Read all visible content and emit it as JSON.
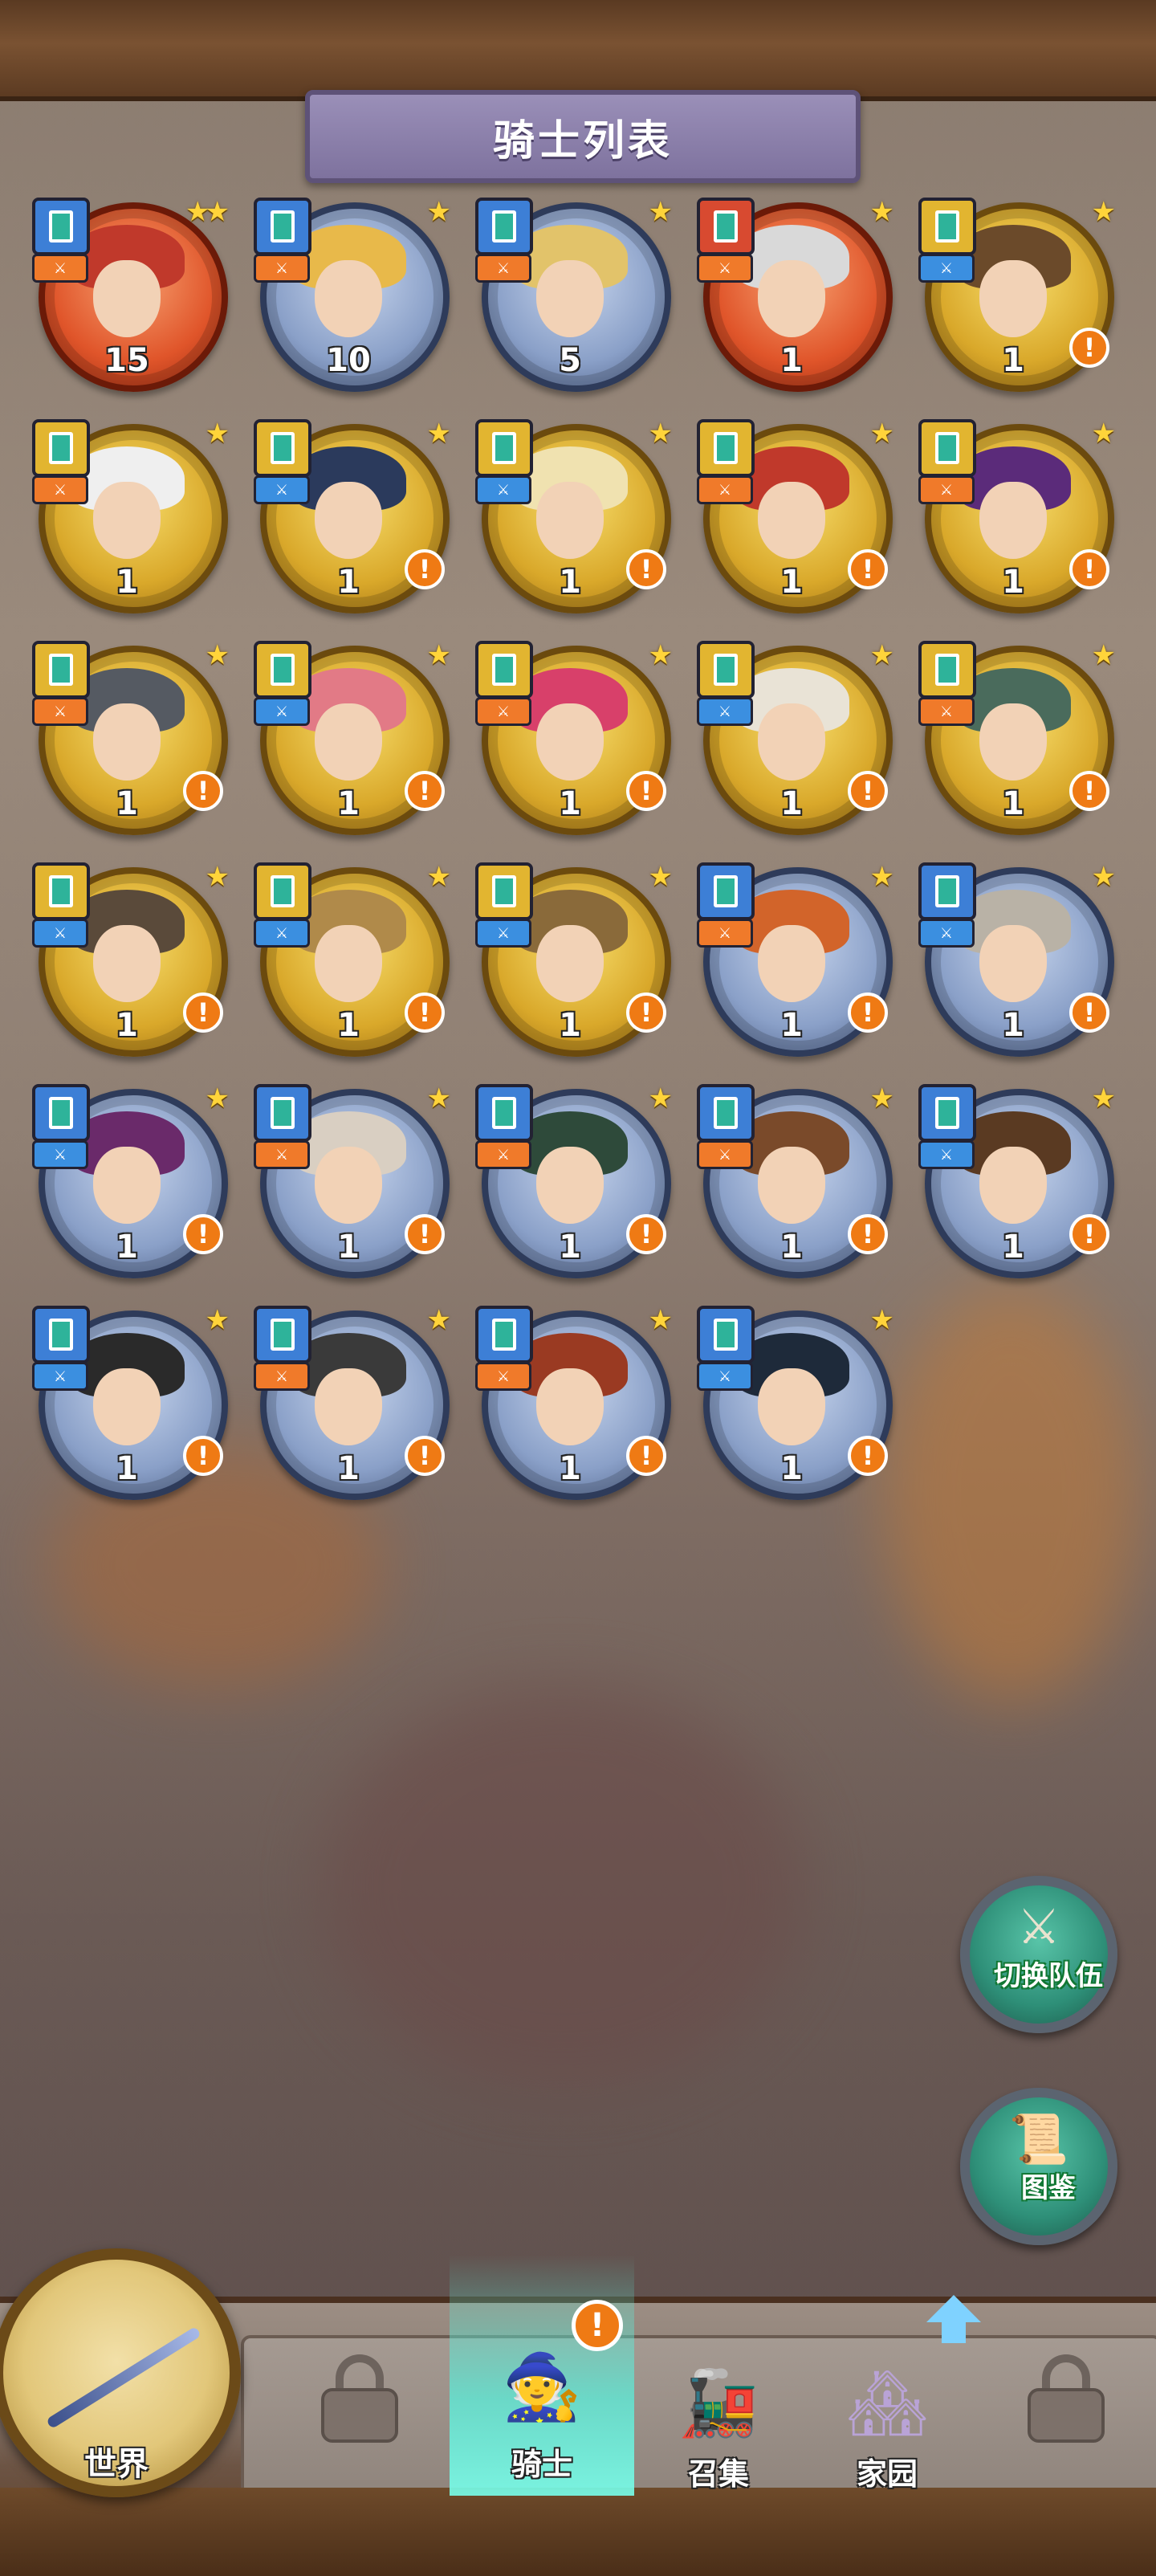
{
  "header": {
    "title": "骑士列表"
  },
  "colors": {
    "gold_ring": "#d9a82a",
    "blue_ring": "#8aa0c8",
    "red_ring": "#e0552a",
    "alert": "#ef7a14",
    "active_tab": "#5af0dc"
  },
  "knights": [
    {
      "count": "15",
      "ring": "red",
      "stars": "★★",
      "badge": "blue",
      "role": "orange",
      "alert": false,
      "hair": "#c0392b"
    },
    {
      "count": "10",
      "ring": "blue",
      "stars": "★",
      "badge": "blue",
      "role": "orange",
      "alert": false,
      "hair": "#e8b94a"
    },
    {
      "count": "5",
      "ring": "blue",
      "stars": "★",
      "badge": "blue",
      "role": "orange",
      "alert": false,
      "hair": "#e2c36a"
    },
    {
      "count": "1",
      "ring": "red",
      "stars": "★",
      "badge": "red",
      "role": "orange",
      "alert": false,
      "hair": "#d9d9d9"
    },
    {
      "count": "1",
      "ring": "gold",
      "stars": "★",
      "badge": "gold",
      "role": "blue",
      "alert": true,
      "hair": "#6b4a2a"
    },
    {
      "count": "1",
      "ring": "gold",
      "stars": "★",
      "badge": "gold",
      "role": "orange",
      "alert": false,
      "hair": "#efefef"
    },
    {
      "count": "1",
      "ring": "gold",
      "stars": "★",
      "badge": "gold",
      "role": "blue",
      "alert": true,
      "hair": "#2b3a5c"
    },
    {
      "count": "1",
      "ring": "gold",
      "stars": "★",
      "badge": "gold",
      "role": "blue",
      "alert": true,
      "hair": "#f0e2b0"
    },
    {
      "count": "1",
      "ring": "gold",
      "stars": "★",
      "badge": "gold",
      "role": "orange",
      "alert": true,
      "hair": "#c0392b"
    },
    {
      "count": "1",
      "ring": "gold",
      "stars": "★",
      "badge": "gold",
      "role": "orange",
      "alert": true,
      "hair": "#5b2b7a"
    },
    {
      "count": "1",
      "ring": "gold",
      "stars": "★",
      "badge": "gold",
      "role": "orange",
      "alert": true,
      "hair": "#555a62"
    },
    {
      "count": "1",
      "ring": "gold",
      "stars": "★",
      "badge": "gold",
      "role": "blue",
      "alert": true,
      "hair": "#e27a86"
    },
    {
      "count": "1",
      "ring": "gold",
      "stars": "★",
      "badge": "gold",
      "role": "orange",
      "alert": true,
      "hair": "#d8406a"
    },
    {
      "count": "1",
      "ring": "gold",
      "stars": "★",
      "badge": "gold",
      "role": "blue",
      "alert": true,
      "hair": "#e9e3d6"
    },
    {
      "count": "1",
      "ring": "gold",
      "stars": "★",
      "badge": "gold",
      "role": "orange",
      "alert": true,
      "hair": "#4a6b5c"
    },
    {
      "count": "1",
      "ring": "gold",
      "stars": "★",
      "badge": "gold",
      "role": "blue",
      "alert": true,
      "hair": "#5a4a3a"
    },
    {
      "count": "1",
      "ring": "gold",
      "stars": "★",
      "badge": "gold",
      "role": "blue",
      "alert": true,
      "hair": "#b08a4a"
    },
    {
      "count": "1",
      "ring": "gold",
      "stars": "★",
      "badge": "gold",
      "role": "blue",
      "alert": true,
      "hair": "#8a6a3a"
    },
    {
      "count": "1",
      "ring": "blue",
      "stars": "★",
      "badge": "blue",
      "role": "orange",
      "alert": true,
      "hair": "#d2642a"
    },
    {
      "count": "1",
      "ring": "blue",
      "stars": "★",
      "badge": "blue",
      "role": "blue",
      "alert": true,
      "hair": "#b9b2a6"
    },
    {
      "count": "1",
      "ring": "blue",
      "stars": "★",
      "badge": "blue",
      "role": "blue",
      "alert": true,
      "hair": "#6a2a6a"
    },
    {
      "count": "1",
      "ring": "blue",
      "stars": "★",
      "badge": "blue",
      "role": "orange",
      "alert": true,
      "hair": "#d9cfc2"
    },
    {
      "count": "1",
      "ring": "blue",
      "stars": "★",
      "badge": "blue",
      "role": "orange",
      "alert": true,
      "hair": "#2e4a3a"
    },
    {
      "count": "1",
      "ring": "blue",
      "stars": "★",
      "badge": "blue",
      "role": "orange",
      "alert": true,
      "hair": "#7a4a2a"
    },
    {
      "count": "1",
      "ring": "blue",
      "stars": "★",
      "badge": "blue",
      "role": "blue",
      "alert": true,
      "hair": "#5a3a22"
    },
    {
      "count": "1",
      "ring": "blue",
      "stars": "★",
      "badge": "blue",
      "role": "blue",
      "alert": true,
      "hair": "#2a2a2a"
    },
    {
      "count": "1",
      "ring": "blue",
      "stars": "★",
      "badge": "blue",
      "role": "orange",
      "alert": true,
      "hair": "#3a3a3a"
    },
    {
      "count": "1",
      "ring": "blue",
      "stars": "★",
      "badge": "blue",
      "role": "orange",
      "alert": true,
      "hair": "#9a3a22"
    },
    {
      "count": "1",
      "ring": "blue",
      "stars": "★",
      "badge": "blue",
      "role": "blue",
      "alert": true,
      "hair": "#1e2a3a"
    }
  ],
  "side_buttons": {
    "switch_team": "切换队伍",
    "codex": "图鉴"
  },
  "nav": {
    "world": "世界",
    "knights": "骑士",
    "summon": "召集",
    "home": "家园",
    "knights_alert": "!"
  }
}
